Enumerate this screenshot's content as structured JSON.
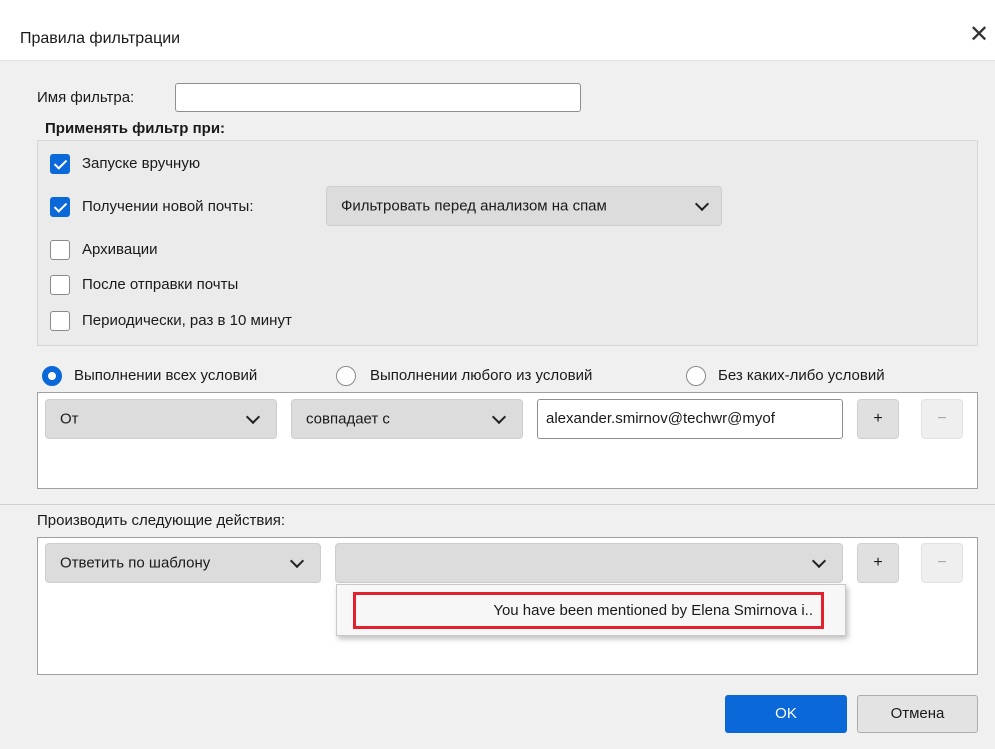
{
  "dialog": {
    "title": "Правила фильтрации",
    "close_glyph": "✕"
  },
  "filter_name": {
    "label": "Имя фильтра:",
    "value": ""
  },
  "apply_group": {
    "heading": "Применять фильтр при:",
    "manual": {
      "label": "Запуске вручную",
      "checked": true
    },
    "new_mail": {
      "label": "Получении новой почты:",
      "checked": true
    },
    "new_mail_mode": "Фильтровать перед анализом на спам",
    "archive": {
      "label": "Архивации",
      "checked": false
    },
    "after_send": {
      "label": "После отправки почты",
      "checked": false
    },
    "periodic": {
      "label": "Периодически, раз в 10 минут",
      "checked": false
    }
  },
  "match_mode": {
    "all": "Выполнении всех условий",
    "any": "Выполнении любого из условий",
    "none": "Без каких-либо условий",
    "selected": "all"
  },
  "condition": {
    "field": "От",
    "operator": "совпадает с",
    "value": "alexander.smirnov@techwr@myof",
    "add": "+",
    "remove": "−"
  },
  "actions": {
    "label": "Производить следующие действия:",
    "action": "Ответить по шаблону",
    "template_value": "",
    "add": "+",
    "remove": "−",
    "popup_item": "You have been mentioned by Elena Smirnova i.."
  },
  "footer": {
    "ok": "OK",
    "cancel": "Отмена"
  },
  "colors": {
    "accent": "#0a68d9",
    "highlight": "#e3202d"
  }
}
